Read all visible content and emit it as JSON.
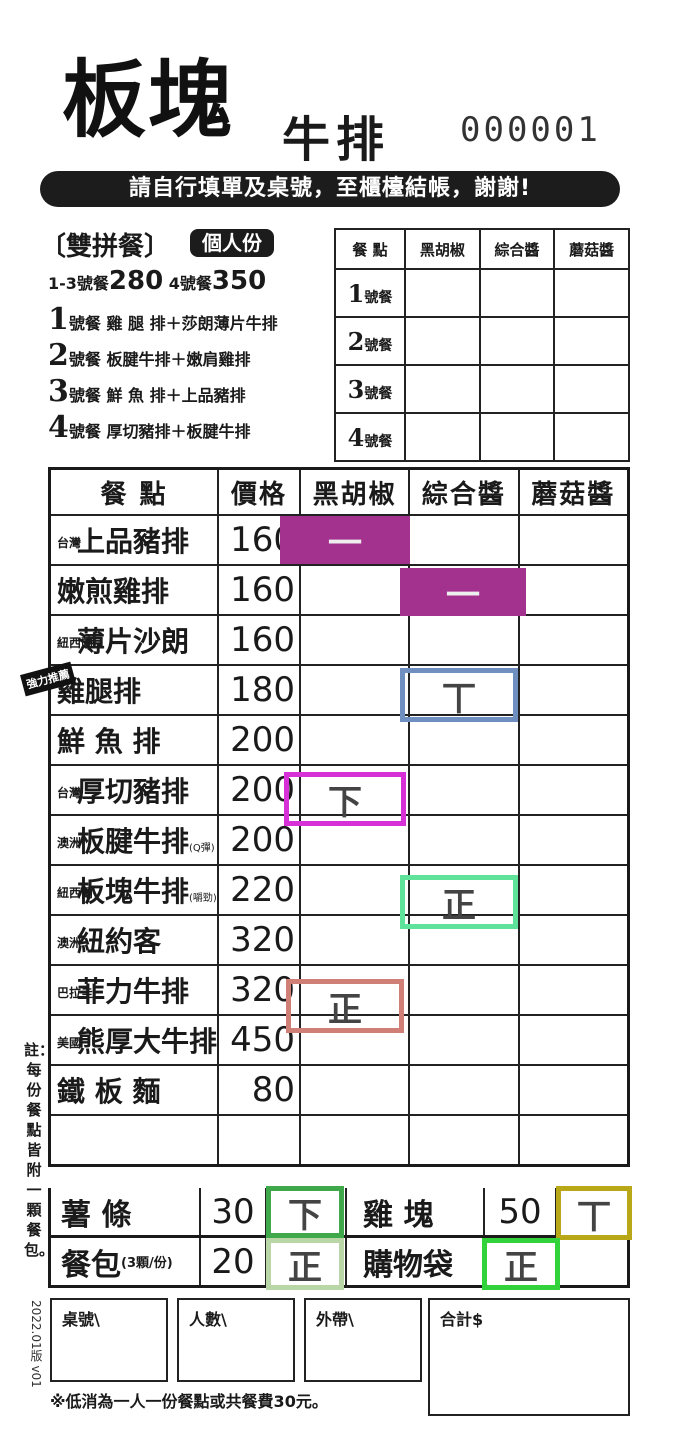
{
  "header": {
    "brand": "板塊",
    "brand_sub": "牛排",
    "serial": "000001",
    "banner": "請自行填單及桌號，至櫃檯結帳，謝謝!"
  },
  "combo": {
    "title": "〔雙拼餐〕",
    "pill": "個人份",
    "price_a_label": "1-3號餐",
    "price_a": "280",
    "price_b_label": "4號餐",
    "price_b": "350",
    "lines": [
      {
        "num": "1",
        "text": "號餐  雞 腿 排＋莎朗薄片牛排"
      },
      {
        "num": "2",
        "text": "號餐  板腱牛排＋嫩肩雞排"
      },
      {
        "num": "3",
        "text": "號餐  鮮 魚 排＋上品豬排"
      },
      {
        "num": "4",
        "text": "號餐  厚切豬排＋板腱牛排"
      }
    ],
    "table_headers": [
      "餐 點",
      "黑胡椒",
      "綜合醬",
      "蘑菇醬"
    ],
    "table_rows": [
      "1",
      "2",
      "3",
      "4"
    ],
    "meal_suffix": "號餐"
  },
  "menu": {
    "headers": [
      "餐   點",
      "價格",
      "黑胡椒",
      "綜合醬",
      "蘑菇醬"
    ],
    "items": [
      {
        "origin": "台灣",
        "name": "上品豬排",
        "price": "160",
        "note": ""
      },
      {
        "origin": "",
        "name": "嫩煎雞排",
        "price": "160",
        "note": ""
      },
      {
        "origin": "紐西蘭",
        "name": "薄片沙朗",
        "price": "160",
        "note": ""
      },
      {
        "origin": "",
        "name": "雞腿排",
        "price": "180",
        "note": ""
      },
      {
        "origin": "",
        "name": "鮮 魚 排",
        "price": "200",
        "note": ""
      },
      {
        "origin": "台灣",
        "name": "厚切豬排",
        "price": "200",
        "note": ""
      },
      {
        "origin": "澳洲",
        "name": "板腱牛排",
        "price": "200",
        "note": "(Q彈)"
      },
      {
        "origin": "紐西蘭",
        "name": "板塊牛排",
        "price": "220",
        "note": "(嚼勁)"
      },
      {
        "origin": "澳洲",
        "name": "紐約客",
        "price": "320",
        "note": ""
      },
      {
        "origin": "巴拉圭",
        "name": "菲力牛排",
        "price": "320",
        "note": ""
      },
      {
        "origin": "美國",
        "name": "熊厚大牛排",
        "price": "450",
        "note": ""
      },
      {
        "origin": "",
        "name": "鐵 板 麵",
        "price": "80",
        "note": ""
      }
    ],
    "badge": "強力推薦"
  },
  "sides": [
    {
      "name": "薯    條",
      "price": "30",
      "name2": "雞   塊",
      "price2": "50"
    },
    {
      "name": "餐包",
      "name_note": "(3顆/份)",
      "price": "20",
      "name2": "購物袋",
      "price2": ""
    }
  ],
  "tallies": {
    "row1_black": "一",
    "row2_mixed": "一",
    "row4_mixed": "丅",
    "row6_black": "下",
    "row8_mixed": "正",
    "row10_black": "正",
    "fries": "下",
    "nugget": "丅",
    "bread": "正",
    "bag": "正",
    "colors": [
      "#a3328f",
      "#6f8fc0",
      "#d630d6",
      "#5fe39a",
      "#cf7f76",
      "#3fa84a",
      "#b8a818",
      "#b9d7a6",
      "#32d23a"
    ]
  },
  "footer": {
    "table_no": "桌號\\",
    "people": "人數\\",
    "takeout": "外帶\\",
    "total": "合計$",
    "note": "※低消為一人一份餐點或共餐費30元。",
    "vertical_note": "註：每份餐點皆附一顆餐包。",
    "version": "2022.01版 v01"
  }
}
